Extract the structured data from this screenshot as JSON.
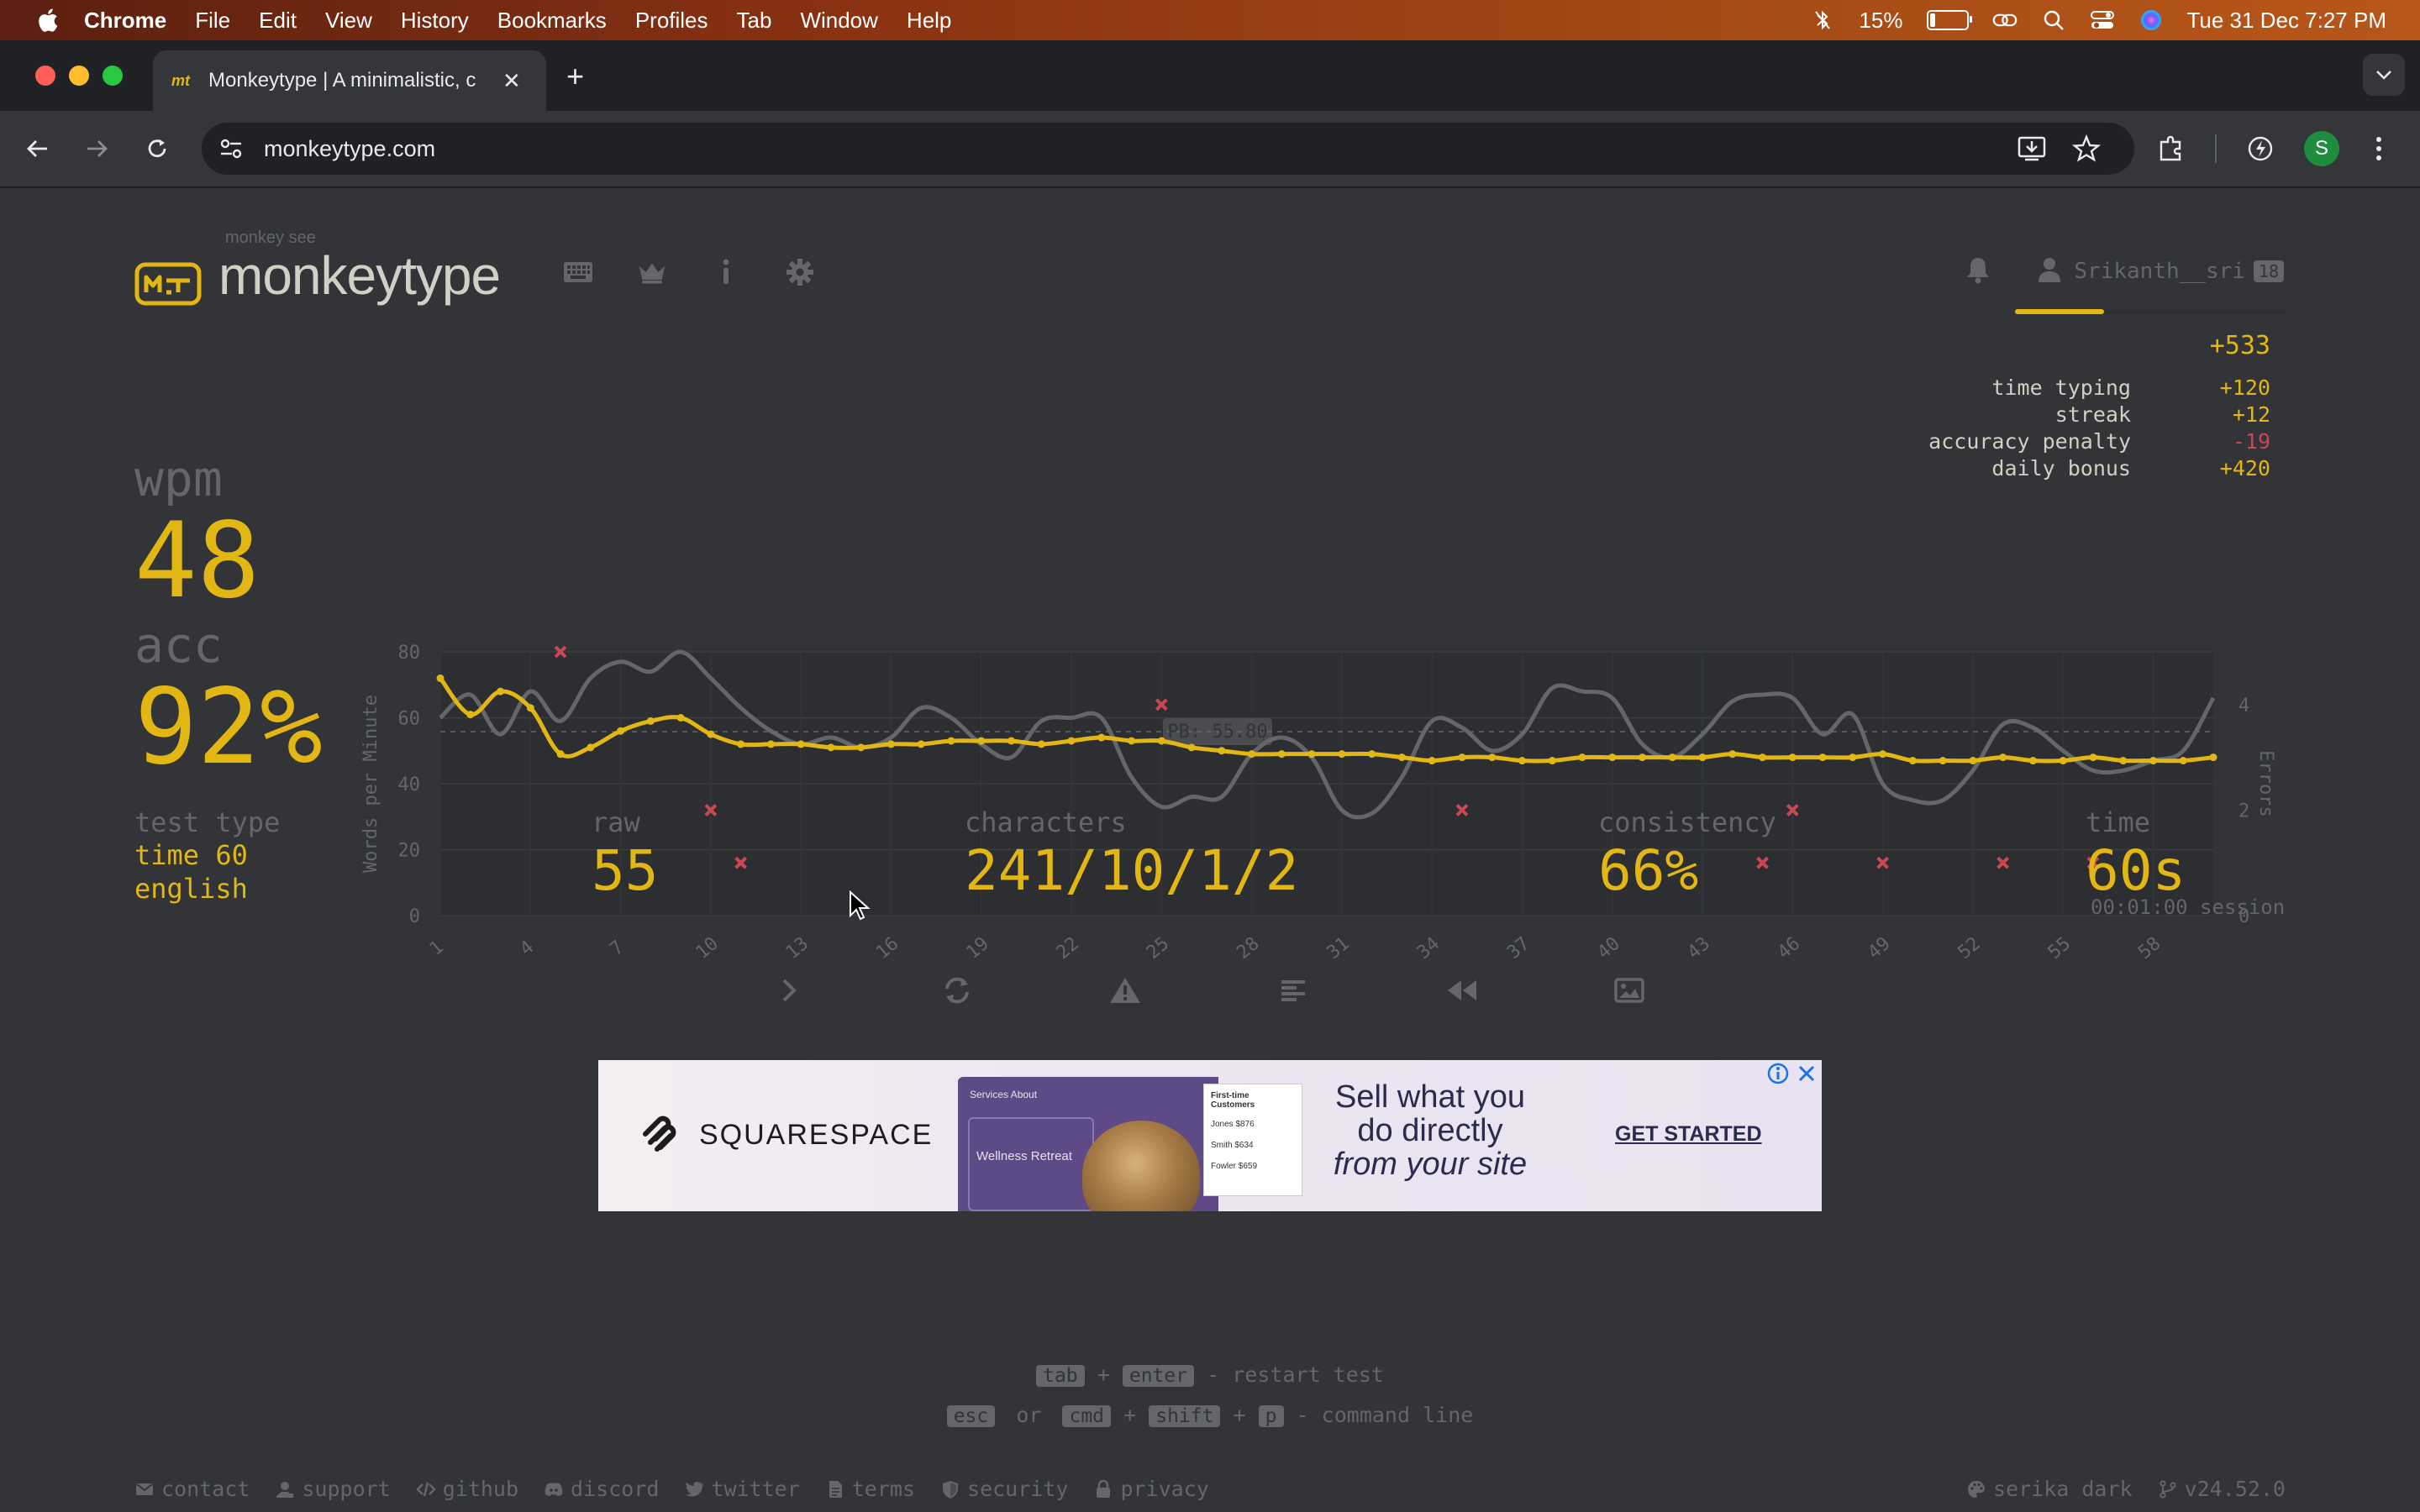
{
  "menubar": {
    "app": "Chrome",
    "items": [
      "File",
      "Edit",
      "View",
      "History",
      "Bookmarks",
      "Profiles",
      "Tab",
      "Window",
      "Help"
    ],
    "battery_percent": "15%",
    "battery_level": 0.15,
    "datetime": "Tue 31 Dec  7:27 PM"
  },
  "browser": {
    "tab_title": "Monkeytype | A minimalistic, c",
    "tab_favicon": "mt",
    "url": "monkeytype.com",
    "profile_initial": "S",
    "new_tab": "+",
    "tab_close": "✕"
  },
  "header": {
    "logo_small": "monkey see",
    "logo_text": "monkeytype",
    "nav_icons": [
      "keyboard-icon",
      "crown-icon",
      "info-icon",
      "gear-icon"
    ],
    "username": "Srikanth__sri",
    "level": "18",
    "xp_progress": 0.33
  },
  "xp": {
    "total": "+533",
    "breakdown": [
      {
        "label": "time typing",
        "value": "+120",
        "negative": false
      },
      {
        "label": "streak",
        "value": "+12",
        "negative": false
      },
      {
        "label": "accuracy penalty",
        "value": "-19",
        "negative": true
      },
      {
        "label": "daily bonus",
        "value": "+420",
        "negative": false
      }
    ]
  },
  "result": {
    "wpm_label": "wpm",
    "wpm": "48",
    "acc_label": "acc",
    "acc": "92%"
  },
  "stats": {
    "test_type_label": "test type",
    "test_type_1": "time 60",
    "test_type_2": "english",
    "raw_label": "raw",
    "raw": "55",
    "characters_label": "characters",
    "characters": "241/10/1/2",
    "consistency_label": "consistency",
    "consistency": "66%",
    "time_label": "time",
    "time": "60s",
    "session": "00:01:00 session"
  },
  "chart_data": {
    "type": "line",
    "ylabel": "Words per Minute",
    "y2label": "Errors",
    "ylim": [
      0,
      80
    ],
    "y2lim": [
      0,
      5
    ],
    "yticks": [
      "0",
      "20",
      "40",
      "60",
      "80"
    ],
    "y2ticks": [
      "0",
      "2",
      "4"
    ],
    "xticks": [
      "1",
      "4",
      "7",
      "10",
      "13",
      "16",
      "19",
      "22",
      "25",
      "28",
      "31",
      "34",
      "37",
      "40",
      "43",
      "46",
      "49",
      "52",
      "55",
      "58"
    ],
    "pb_label": "PB: 55.80",
    "pb_value": 55.8,
    "colors": {
      "wpm": "#e2b714",
      "raw": "#646669",
      "errors": "#ca4754",
      "bg": "#2c2e31"
    },
    "series": [
      {
        "name": "wpm",
        "x": [
          1,
          2,
          3,
          4,
          5,
          6,
          7,
          8,
          9,
          10,
          11,
          12,
          13,
          14,
          15,
          16,
          17,
          18,
          19,
          20,
          21,
          22,
          23,
          24,
          25,
          26,
          27,
          28,
          29,
          30,
          31,
          32,
          33,
          34,
          35,
          36,
          37,
          38,
          39,
          40,
          41,
          42,
          43,
          44,
          45,
          46,
          47,
          48,
          49,
          50,
          51,
          52,
          53,
          54,
          55,
          56,
          57,
          58,
          59,
          60
        ],
        "values": [
          72,
          61,
          68,
          63,
          49,
          51,
          56,
          59,
          60,
          55,
          52,
          52,
          52,
          51,
          51,
          52,
          52,
          53,
          53,
          53,
          52,
          53,
          54,
          53,
          53,
          51,
          50,
          49,
          49,
          49,
          49,
          49,
          48,
          47,
          48,
          48,
          47,
          47,
          48,
          48,
          48,
          48,
          48,
          49,
          48,
          48,
          48,
          48,
          49,
          47,
          47,
          47,
          48,
          47,
          47,
          48,
          47,
          47,
          47,
          48
        ]
      },
      {
        "name": "raw",
        "x": [
          1,
          2,
          3,
          4,
          5,
          6,
          7,
          8,
          9,
          10,
          11,
          12,
          13,
          14,
          15,
          16,
          17,
          18,
          19,
          20,
          21,
          22,
          23,
          24,
          25,
          26,
          27,
          28,
          29,
          30,
          31,
          32,
          33,
          34,
          35,
          36,
          37,
          38,
          39,
          40,
          41,
          42,
          43,
          44,
          45,
          46,
          47,
          48,
          49,
          50,
          51,
          52,
          53,
          54,
          55,
          56,
          57,
          58,
          59,
          60
        ],
        "values": [
          60,
          67,
          55,
          68,
          59,
          72,
          77,
          74,
          80,
          72,
          63,
          56,
          52,
          54,
          51,
          54,
          63,
          60,
          52,
          48,
          59,
          60,
          60,
          42,
          33,
          36,
          36,
          49,
          54,
          48,
          32,
          31,
          42,
          59,
          57,
          50,
          55,
          69,
          68,
          66,
          52,
          48,
          55,
          65,
          67,
          66,
          55,
          61,
          40,
          35,
          35,
          44,
          58,
          57,
          50,
          44,
          44,
          47,
          50,
          66
        ]
      },
      {
        "name": "errors",
        "x": [
          5,
          10,
          11,
          25,
          35,
          45,
          46,
          49,
          53,
          56
        ],
        "values": [
          5,
          2,
          1,
          4,
          2,
          1,
          2,
          1,
          1,
          1
        ]
      }
    ]
  },
  "actions": [
    "next-test",
    "restart-test",
    "report-issue",
    "words-history",
    "watch-replay",
    "save-screenshot"
  ],
  "ad": {
    "brand": "SQUARESPACE",
    "headline_1": "Sell what you",
    "headline_2": "do directly",
    "headline_3": "from your site",
    "cta": "GET STARTED",
    "panel_title": "Wellness Retreat",
    "panel_nav": "Services   About",
    "table_title": "First-time Customers",
    "table_rows": [
      "Jones   $876",
      "Smith   $634",
      "Fowler  $659"
    ]
  },
  "hints": {
    "key_tab": "tab",
    "plus": "+",
    "key_enter": "enter",
    "restart": "- restart test",
    "key_esc": "esc",
    "or": "or",
    "key_cmd": "cmd",
    "key_shift": "shift",
    "key_p": "p",
    "command": "- command line"
  },
  "footer": {
    "links": [
      "contact",
      "support",
      "github",
      "discord",
      "twitter",
      "terms",
      "security",
      "privacy"
    ],
    "theme": "serika dark",
    "version": "v24.52.0"
  }
}
